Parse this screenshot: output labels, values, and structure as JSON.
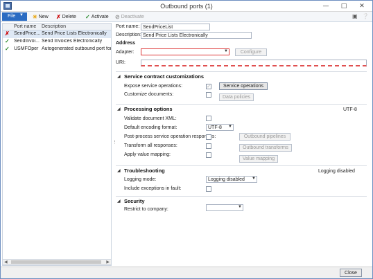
{
  "window": {
    "title": "Outbound ports (1)"
  },
  "toolbar": {
    "file_label": "File",
    "new_label": "New",
    "delete_label": "Delete",
    "activate_label": "Activate",
    "deactivate_label": "Deactivate"
  },
  "grid": {
    "col_name": "Port name",
    "col_desc": "Description",
    "rows": [
      {
        "status": "error",
        "name": "SendPrice...",
        "desc": "Send Price Lists Electronically"
      },
      {
        "status": "ok",
        "name": "SendInvoi...",
        "desc": "Send Invoices Electronically"
      },
      {
        "status": "ok",
        "name": "USMFOper",
        "desc": "Autogenerated outbound port for US"
      }
    ]
  },
  "form": {
    "port_name_label": "Port name:",
    "port_name_value": "SendPriceList",
    "description_label": "Description:",
    "description_value": "Send Price Lists Electronically",
    "address_title": "Address",
    "adapter_label": "Adapter:",
    "adapter_value": "",
    "configure_label": "Configure",
    "uri_label": "URI:",
    "uri_value": ""
  },
  "service": {
    "title": "Service contract customizations",
    "expose_label": "Expose service operations:",
    "expose_checked": true,
    "customize_label": "Customize documents:",
    "service_ops_btn": "Service operations",
    "data_policies_btn": "Data policies"
  },
  "processing": {
    "title": "Processing options",
    "summary": "UTF-8",
    "validate_label": "Validate document XML:",
    "encoding_label": "Default encoding format:",
    "encoding_value": "UTF-8",
    "postprocess_label": "Post-process service operation responses:",
    "outbound_pipelines_btn": "Outbound pipelines",
    "transform_label": "Transform all responses:",
    "outbound_transforms_btn": "Outbound transforms",
    "value_mapping_label": "Apply value mapping:",
    "value_mapping_btn": "Value mapping"
  },
  "troubleshooting": {
    "title": "Troubleshooting",
    "summary": "Logging disabled",
    "logging_label": "Logging mode:",
    "logging_value": "Logging disabled",
    "include_exceptions_label": "Include exceptions in fault:"
  },
  "security": {
    "title": "Security",
    "restrict_label": "Restrict to company:",
    "restrict_value": ""
  },
  "footer": {
    "close_label": "Close"
  },
  "colors": {
    "accent": "#2a6bc2",
    "error": "#cc0000",
    "ok": "#2b8a2b"
  }
}
